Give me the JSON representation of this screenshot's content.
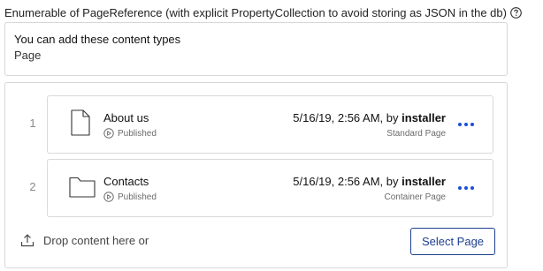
{
  "field": {
    "label": "Enumerable of PageReference (with explicit PropertyCollection to avoid storing as JSON in the db)",
    "help_icon": "question-circle-icon"
  },
  "info": {
    "heading": "You can add these content types",
    "types": "Page"
  },
  "items": [
    {
      "number": "1",
      "icon": "page-icon",
      "title": "About us",
      "status": "Published",
      "date": "5/16/19, 2:56 AM, by",
      "author": "installer",
      "page_type": "Standard Page"
    },
    {
      "number": "2",
      "icon": "folder-icon",
      "title": "Contacts",
      "status": "Published",
      "date": "5/16/19, 2:56 AM, by",
      "author": "installer",
      "page_type": "Container Page"
    }
  ],
  "drop_zone": {
    "text": "Drop content here or",
    "icon": "upload-icon"
  },
  "select_button": {
    "label": "Select Page"
  },
  "colors": {
    "accent": "#1d3f8f",
    "more_dots": "#1d4ed8",
    "border": "#d7d7d7"
  }
}
